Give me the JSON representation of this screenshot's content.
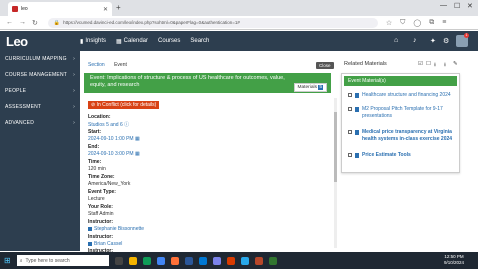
{
  "browser": {
    "tab_title": "leo",
    "url": "https://vcumed.davinci-ed.com/leo/index.php?sohtml=0&paperFlag=0&authentication=1#"
  },
  "app": {
    "logo": "Leo",
    "nav": [
      "Insights",
      "Calendar",
      "Courses",
      "Search"
    ],
    "notification_count": "1"
  },
  "sidebar": {
    "items": [
      {
        "label": "CURRICULUM MAPPING"
      },
      {
        "label": "COURSE MANAGEMENT"
      },
      {
        "label": "PEOPLE"
      },
      {
        "label": "ASSESSMENT"
      },
      {
        "label": "ADVANCED"
      }
    ]
  },
  "breadcrumb": {
    "section": "Section",
    "event": "Event"
  },
  "close_label": "Close",
  "event": {
    "title": "Event: Implications of structure & process of US healthcare for outcomes, value, equity, and research",
    "materials_button": "Materials",
    "materials_count": "5",
    "conflict_label": "In Conflict (click for details)",
    "fields": {
      "location_label": "Location:",
      "location_value": "Studios 5 and 6",
      "start_label": "Start:",
      "start_value": "2024-09-10 1:00 PM",
      "end_label": "End:",
      "end_value": "2024-09-10 3:00 PM",
      "time_label": "Time:",
      "time_value": "120 min",
      "tz_label": "Time Zone:",
      "tz_value": "America/New_York",
      "type_label": "Event Type:",
      "type_value": "Lecture",
      "role_label": "Your Role:",
      "role_value": "Staff Admin",
      "instructor1_label": "Instructor:",
      "instructor1_value": "Stephanie Bissonnette",
      "instructor2_label": "Instructor:",
      "instructor2_value": "Brian Cassel",
      "instructor3_label": "Instructor:"
    }
  },
  "related": {
    "title": "Related Materials",
    "header": "Event Material(s)",
    "items": [
      {
        "label": "Healthcare structure and financing 2024"
      },
      {
        "label": "M2 Proposal Pitch Template for 9-17 presentations"
      },
      {
        "label": "Medical price transparency at Virginia health systems in-class exercise 2024"
      },
      {
        "label": "Price Estimate Tools"
      }
    ]
  },
  "taskbar": {
    "search_placeholder": "Type here to search",
    "time": "12:50 PM",
    "date": "9/10/2024"
  }
}
